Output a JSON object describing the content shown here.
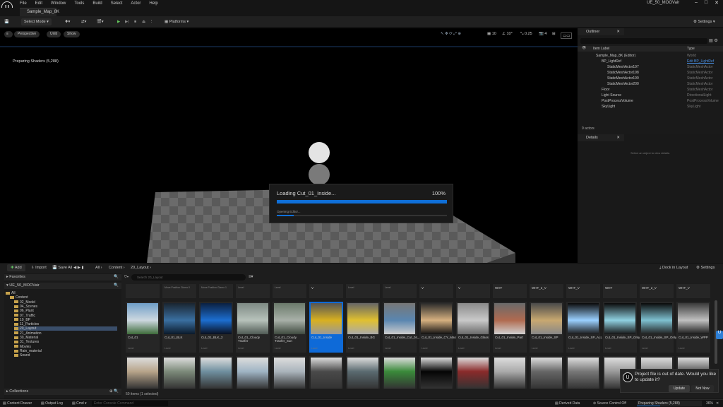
{
  "app": {
    "title": "UE_50_MOOVair",
    "map_tab": "Sample_Map_8K"
  },
  "menu": [
    "File",
    "Edit",
    "Window",
    "Tools",
    "Build",
    "Select",
    "Actor",
    "Help"
  ],
  "toolbar": {
    "mode": "Select Mode",
    "platforms": "Platforms",
    "settings": "Settings"
  },
  "viewport": {
    "perspective": "Perspective",
    "lit": "Unlit",
    "show": "Show",
    "preparing": "Preparing Shaders (5,288)",
    "grid_size": "10",
    "angle": "10°",
    "scale": "0.25",
    "cam_speed": "4"
  },
  "loading": {
    "title": "Loading Cut_01_Inside...",
    "percent_text": "100%",
    "progress": 1.0,
    "sub": "Opening Editor...",
    "sub_progress": 0.1
  },
  "outliner": {
    "title": "Outliner",
    "col_label": "Item Label",
    "col_type": "Type",
    "rows": [
      {
        "label": "Sample_Map_8K (Editor)",
        "type": "World",
        "indent": 0
      },
      {
        "label": "BP_LightRef",
        "type": "Edit BP_LightRef",
        "indent": 1,
        "link": true
      },
      {
        "label": "StaticMeshActor197",
        "type": "StaticMeshActor",
        "indent": 2
      },
      {
        "label": "StaticMeshActor198",
        "type": "StaticMeshActor",
        "indent": 2
      },
      {
        "label": "StaticMeshActor199",
        "type": "StaticMeshActor",
        "indent": 2
      },
      {
        "label": "StaticMeshActor200",
        "type": "StaticMeshActor",
        "indent": 2
      },
      {
        "label": "Floor",
        "type": "StaticMeshActor",
        "indent": 1
      },
      {
        "label": "Light Source",
        "type": "DirectionalLight",
        "indent": 1
      },
      {
        "label": "PostProcessVolume",
        "type": "PostProcessVolume",
        "indent": 1
      },
      {
        "label": "SkyLight",
        "type": "SkyLight",
        "indent": 1
      }
    ],
    "count": "9 actors"
  },
  "details": {
    "title": "Details",
    "empty": "Select an object to view details."
  },
  "content_browser": {
    "add": "Add",
    "import": "Import",
    "save_all": "Save All",
    "crumbs": [
      "All",
      "Content",
      "20_Layout"
    ],
    "dock": "Dock in Layout",
    "settings": "Settings",
    "search_placeholder": "Search 20_Layout",
    "favorites": "Favorites",
    "collections": "Collections",
    "root": "UE_50_MOOVair",
    "tree": [
      "All",
      "Content",
      "02_Model",
      "04_Scenes",
      "06_Plant",
      "07_Traffic",
      "10_BP",
      "11_Particles",
      "20_Layout",
      "21_Animation",
      "30_Material",
      "31_Textures",
      "Movies",
      "Rain_material",
      "Sound"
    ],
    "item_count": "50 items (1 selected)",
    "top_row": [
      "",
      "Move Position Gizmo 0",
      "Move Position Gizmo 1",
      "Level",
      "Level",
      "V",
      "Level",
      "Level",
      "V",
      "V",
      "WHT",
      "WHT_2_V",
      "WHT_V",
      "WHT",
      "WHT_2_V",
      "WHT_V"
    ],
    "assets": [
      {
        "name": "Cut_01",
        "kind": "Level"
      },
      {
        "name": "Cut_01_BLK",
        "kind": "Level"
      },
      {
        "name": "Cut_01_BLK_2",
        "kind": "Level"
      },
      {
        "name": "Cut_01_Cloudy Tranfer",
        "kind": "Level"
      },
      {
        "name": "Cut_01_Cloudy Tranfer_Sun",
        "kind": "Level"
      },
      {
        "name": "Cut_01_Inside",
        "kind": "Level",
        "selected": true
      },
      {
        "name": "Cut_01_Inside_BG",
        "kind": "Level"
      },
      {
        "name": "Cut_01_Inside_Cut_04_Alt",
        "kind": "Level"
      },
      {
        "name": "Cut_01_Inside_CY_Mask",
        "kind": "Level"
      },
      {
        "name": "Cut_01_Inside_Glass",
        "kind": "Level"
      },
      {
        "name": "Cut_01_Inside_Part",
        "kind": "Level"
      },
      {
        "name": "Cut_01_Inside_SP",
        "kind": "Level"
      },
      {
        "name": "Cut_01_Inside_SP_ALL",
        "kind": "Level"
      },
      {
        "name": "Cut_01_Inside_SP_Only",
        "kind": "Level"
      },
      {
        "name": "Cut_01_Inside_SP_Only_2",
        "kind": "Level"
      },
      {
        "name": "Cut_01_Inside_WPP",
        "kind": "Level"
      }
    ]
  },
  "toast": {
    "message": "Project file is out of date. Would you like to update it?",
    "update": "Update",
    "not_now": "Not Now"
  },
  "status": {
    "drawer": "Content Drawer",
    "log": "Output Log",
    "cmd": "Cmd",
    "console_placeholder": "Enter Console Command",
    "ddc": "Derived Data",
    "scc": "Source Control Off",
    "shaders": "Preparing Shaders (5,288)",
    "pct": "36%"
  },
  "colors": {
    "accent": "#0f6fd8",
    "selected": "#0e6ad8",
    "folder": "#c6a24c"
  }
}
